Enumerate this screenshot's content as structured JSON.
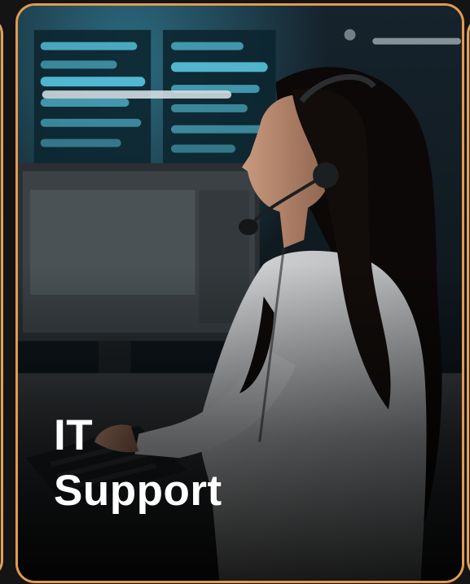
{
  "card": {
    "title_line_1": "IT",
    "title_line_2": "Support",
    "accent_border_color": "#e39a4f",
    "image_subject": "support-agent-with-headset-at-workstation"
  }
}
